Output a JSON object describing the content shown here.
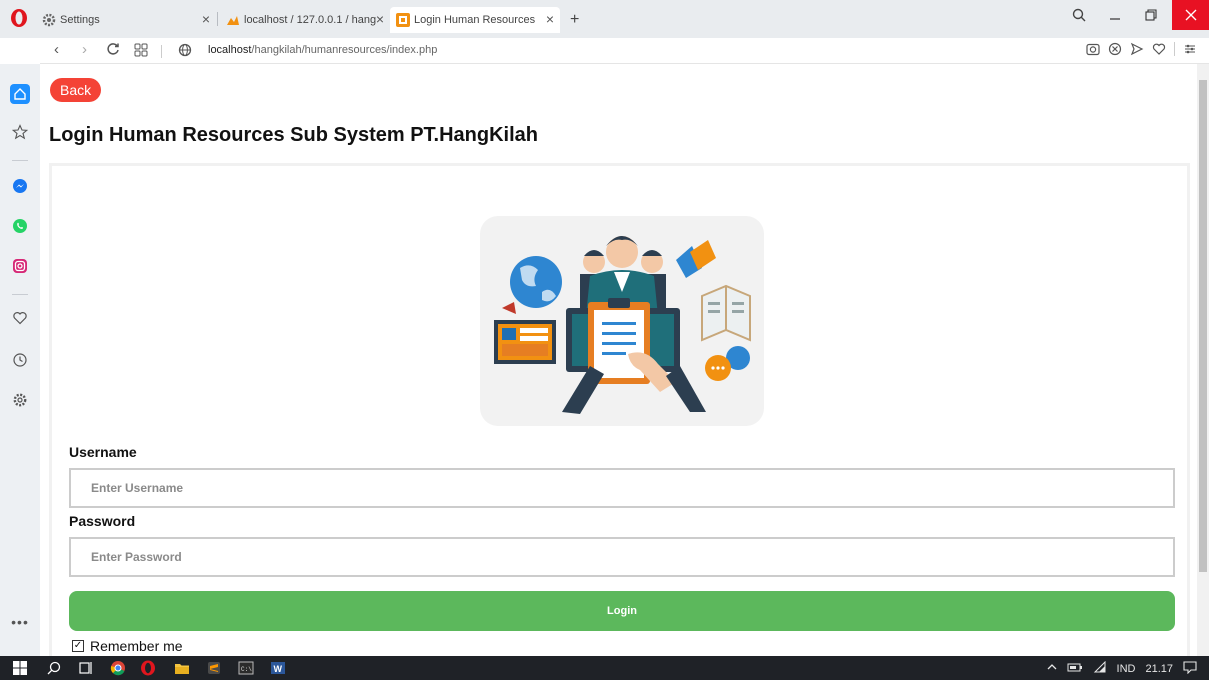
{
  "browser": {
    "tabs": [
      {
        "label": "Settings"
      },
      {
        "label": "localhost / 127.0.0.1 / hang"
      },
      {
        "label": "Login Human Resources"
      }
    ],
    "new_tab": "+",
    "url_host": "localhost",
    "url_path": "/hangkilah/humanresources/index.php"
  },
  "page": {
    "back_label": "Back",
    "title": "Login Human Resources Sub System PT.HangKilah",
    "username_label": "Username",
    "username_placeholder": "Enter Username",
    "password_label": "Password",
    "password_placeholder": "Enter Password",
    "login_label": "Login",
    "remember_label": "Remember me",
    "remember_checked": true
  },
  "taskbar": {
    "language": "IND",
    "time": "21.17"
  },
  "colors": {
    "back_button": "#f44336",
    "login_button": "#5cb85c",
    "close_button": "#e81123",
    "opera_red": "#e0161e"
  }
}
